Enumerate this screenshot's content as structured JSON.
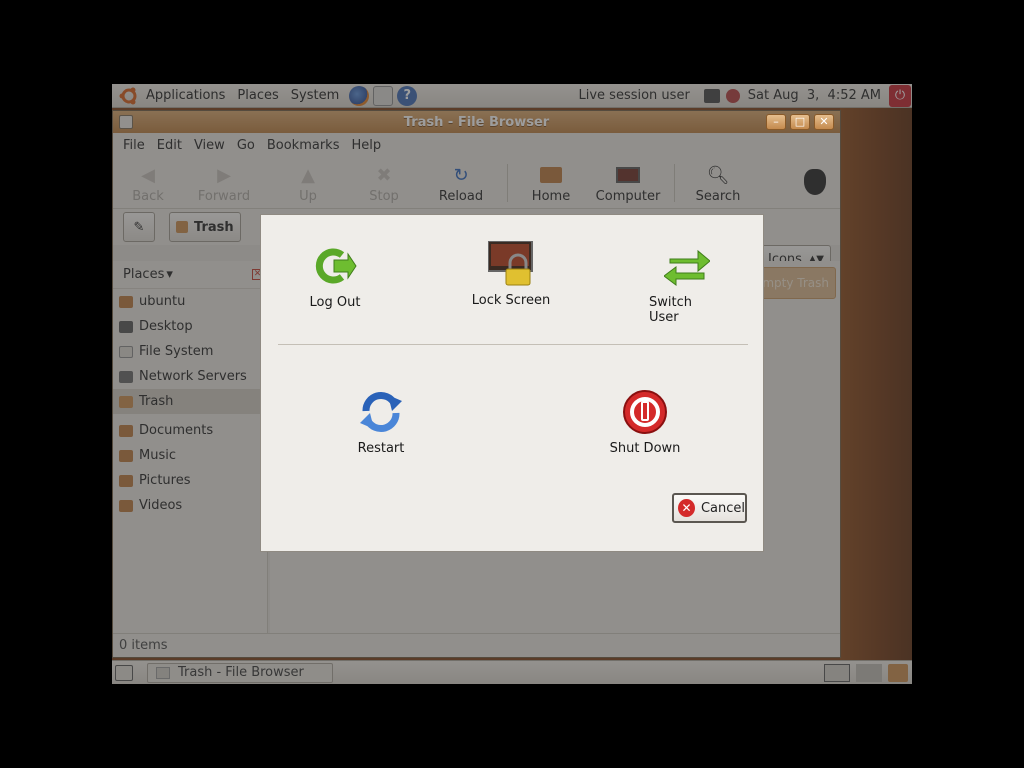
{
  "top_panel": {
    "menus": [
      "Applications",
      "Places",
      "System"
    ],
    "user": "Live session user",
    "datetime": "Sat Aug  3,  4:52 AM"
  },
  "window": {
    "title": "Trash - File Browser",
    "menubar": [
      "File",
      "Edit",
      "View",
      "Go",
      "Bookmarks",
      "Help"
    ],
    "toolbar": {
      "back": "Back",
      "forward": "Forward",
      "up": "Up",
      "stop": "Stop",
      "reload": "Reload",
      "home": "Home",
      "computer": "Computer",
      "search": "Search"
    },
    "location": {
      "current": "Trash",
      "view_mode": "Icons"
    },
    "sidebar": {
      "header": "Places",
      "items": [
        "ubuntu",
        "Desktop",
        "File System",
        "Network Servers",
        "Trash",
        "Documents",
        "Music",
        "Pictures",
        "Videos"
      ]
    },
    "empty_trash": "Empty Trash",
    "status": "0 items"
  },
  "bottom_panel": {
    "task": "Trash - File Browser"
  },
  "dialog": {
    "log_out": "Log Out",
    "lock_screen": "Lock Screen",
    "switch_user": "Switch User",
    "restart": "Restart",
    "shut_down": "Shut Down",
    "cancel": "Cancel"
  },
  "colors": {
    "accent": "#c0202a",
    "titlebar": "#c88c4c",
    "reload": "#2a62b8",
    "logout": "#5aa828"
  }
}
